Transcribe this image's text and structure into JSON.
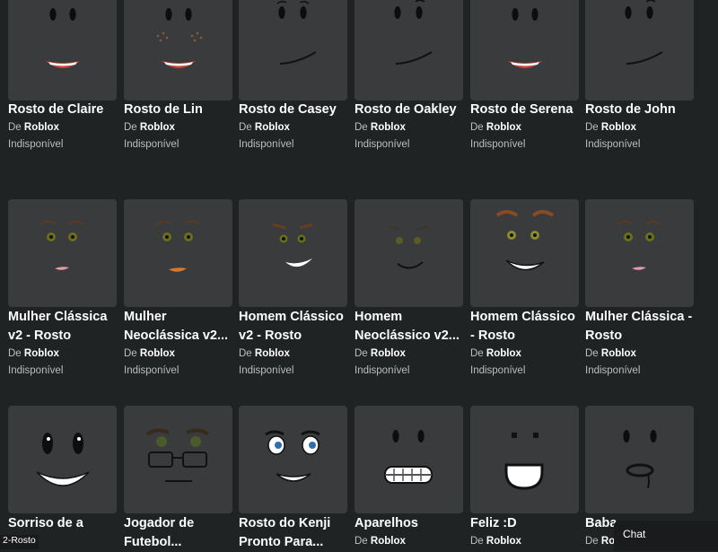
{
  "creator_prefix": "De",
  "items": [
    {
      "name": "Rosto de Claire",
      "creator": "Roblox",
      "status": "Indisponível",
      "face": "smile-teeth"
    },
    {
      "name": "Rosto de Lin",
      "creator": "Roblox",
      "status": "Indisponível",
      "face": "smile-teeth-freckles"
    },
    {
      "name": "Rosto de Casey",
      "creator": "Roblox",
      "status": "Indisponível",
      "face": "smirk-brows"
    },
    {
      "name": "Rosto de Oakley",
      "creator": "Roblox",
      "status": "Indisponível",
      "face": "smirk-brow"
    },
    {
      "name": "Rosto de Serena",
      "creator": "Roblox",
      "status": "Indisponível",
      "face": "smile-teeth"
    },
    {
      "name": "Rosto de John",
      "creator": "Roblox",
      "status": "Indisponível",
      "face": "smirk-brow"
    },
    {
      "name": "Mulher Clássica v2 - Rosto",
      "creator": "Roblox",
      "status": "Indisponível",
      "face": "woman-pink"
    },
    {
      "name": "Mulher Neoclássica v2...",
      "creator": "Roblox",
      "status": "Indisponível",
      "face": "woman-orange"
    },
    {
      "name": "Homem Clássico v2 - Rosto",
      "creator": "Roblox",
      "status": "Indisponível",
      "face": "man-grin"
    },
    {
      "name": "Homem Neoclássico v2...",
      "creator": "Roblox",
      "status": "Indisponível",
      "face": "man-smile"
    },
    {
      "name": "Homem Clássico - Rosto",
      "creator": "Roblox",
      "status": "Indisponível",
      "face": "man-big-grin"
    },
    {
      "name": "Mulher Clássica - Rosto",
      "creator": "Roblox",
      "status": "Indisponível",
      "face": "woman-pink"
    },
    {
      "name": "Sorriso de a",
      "creator": "",
      "status": "",
      "face": "big-smile"
    },
    {
      "name": "Jogador de Futebol...",
      "creator": "",
      "status": "",
      "face": "glasses"
    },
    {
      "name": "Rosto do Kenji Pronto Para...",
      "creator": "",
      "status": "",
      "face": "kenji"
    },
    {
      "name": "Aparelhos",
      "creator": "Roblox",
      "status": "",
      "face": "braces"
    },
    {
      "name": "Feliz :D",
      "creator": "Roblox",
      "status": "",
      "face": "happy-d"
    },
    {
      "name": "Baba",
      "creator": "Ro",
      "status": "",
      "face": "drool"
    }
  ],
  "chat": {
    "label": "Chat"
  },
  "tooltip": {
    "text": "2-Rosto"
  },
  "colors": {
    "background": "#1f2324",
    "tile": "#393b3d",
    "muted_text": "#bdbebe",
    "chat_bg": "#191b1d"
  }
}
